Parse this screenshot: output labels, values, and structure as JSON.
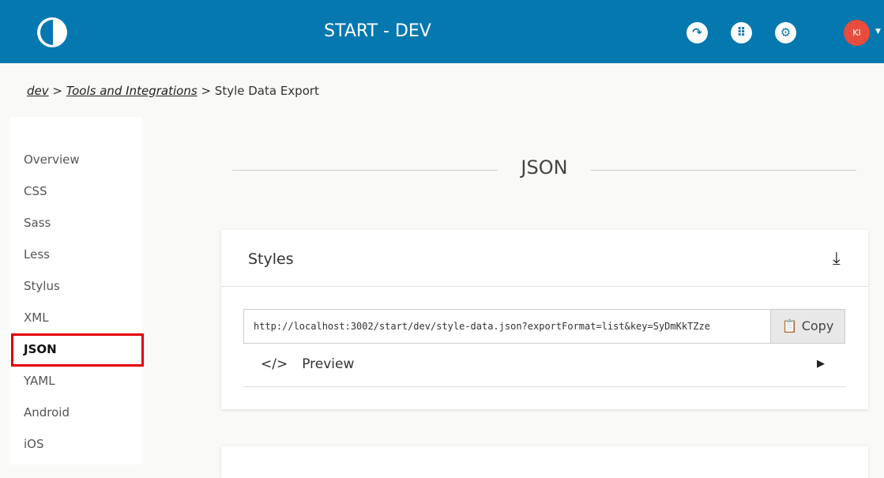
{
  "header": {
    "title": "START - DEV",
    "avatar_initials": "KI",
    "icons": [
      "share-icon",
      "apps-grid-icon",
      "settings-icon"
    ],
    "color": "#0478af"
  },
  "breadcrumb": {
    "items": [
      "dev",
      "Tools and Integrations"
    ],
    "current": "Style Data Export",
    "separator": ">"
  },
  "sidebar": {
    "items": [
      {
        "label": "Overview"
      },
      {
        "label": "CSS"
      },
      {
        "label": "Sass"
      },
      {
        "label": "Less"
      },
      {
        "label": "Stylus"
      },
      {
        "label": "XML"
      },
      {
        "label": "JSON",
        "active": true
      },
      {
        "label": "YAML"
      },
      {
        "label": "Android"
      },
      {
        "label": "iOS"
      }
    ]
  },
  "main": {
    "section_title": "JSON",
    "card": {
      "title": "Styles",
      "url": "http://localhost:3002/start/dev/style-data.json?exportFormat=list&key=SyDmKkTZze",
      "copy_label": "Copy",
      "preview_label": "Preview"
    }
  }
}
